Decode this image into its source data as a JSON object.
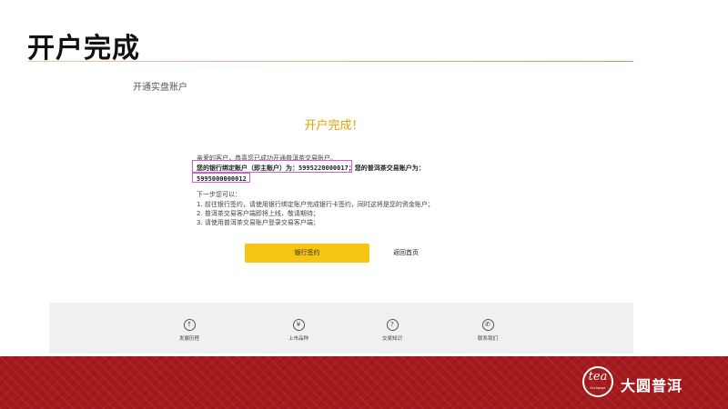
{
  "slide": {
    "title": "开户完成"
  },
  "page": {
    "section_label": "开通实盘账户",
    "success_title": "开户完成！",
    "message": {
      "line1": "亲爱的客户，恭喜您已成功开通普洱茶交易账户。",
      "bind_label": "您的银行绑定账户（即主账户）为：",
      "bind_account": "5995220000017",
      "trade_label": "；您的普洱茶交易账户为：",
      "trade_account": "5995000000012"
    },
    "next_steps": {
      "heading": "下一步您可以：",
      "items": [
        "1. 前往银行签约，请使用银行绑定账户完成银行卡签约，同时这将是您的资金账户；",
        "2. 普洱茶交易客户端即将上线，敬请期待；",
        "3. 请使用普洱茶交易账户登录交易客户端；"
      ]
    },
    "buttons": {
      "primary": "银行签约",
      "secondary": "返回首页"
    }
  },
  "footer": {
    "items": [
      {
        "label": "发展历程",
        "icon": "arrow-up-circle-icon",
        "glyph": "↑"
      },
      {
        "label": "上市品种",
        "icon": "yen-circle-icon",
        "glyph": "¥"
      },
      {
        "label": "交易知识",
        "icon": "question-circle-icon",
        "glyph": "?"
      },
      {
        "label": "联系我们",
        "icon": "phone-circle-icon",
        "glyph": "✆"
      }
    ]
  },
  "brand": {
    "logo_text": "tea",
    "logo_sub": "Exchange",
    "name": "大圆普洱"
  },
  "colors": {
    "accent": "#f6c412",
    "success": "#e8a200",
    "highlight": "#d35bd6",
    "band": "#a51a1c"
  }
}
